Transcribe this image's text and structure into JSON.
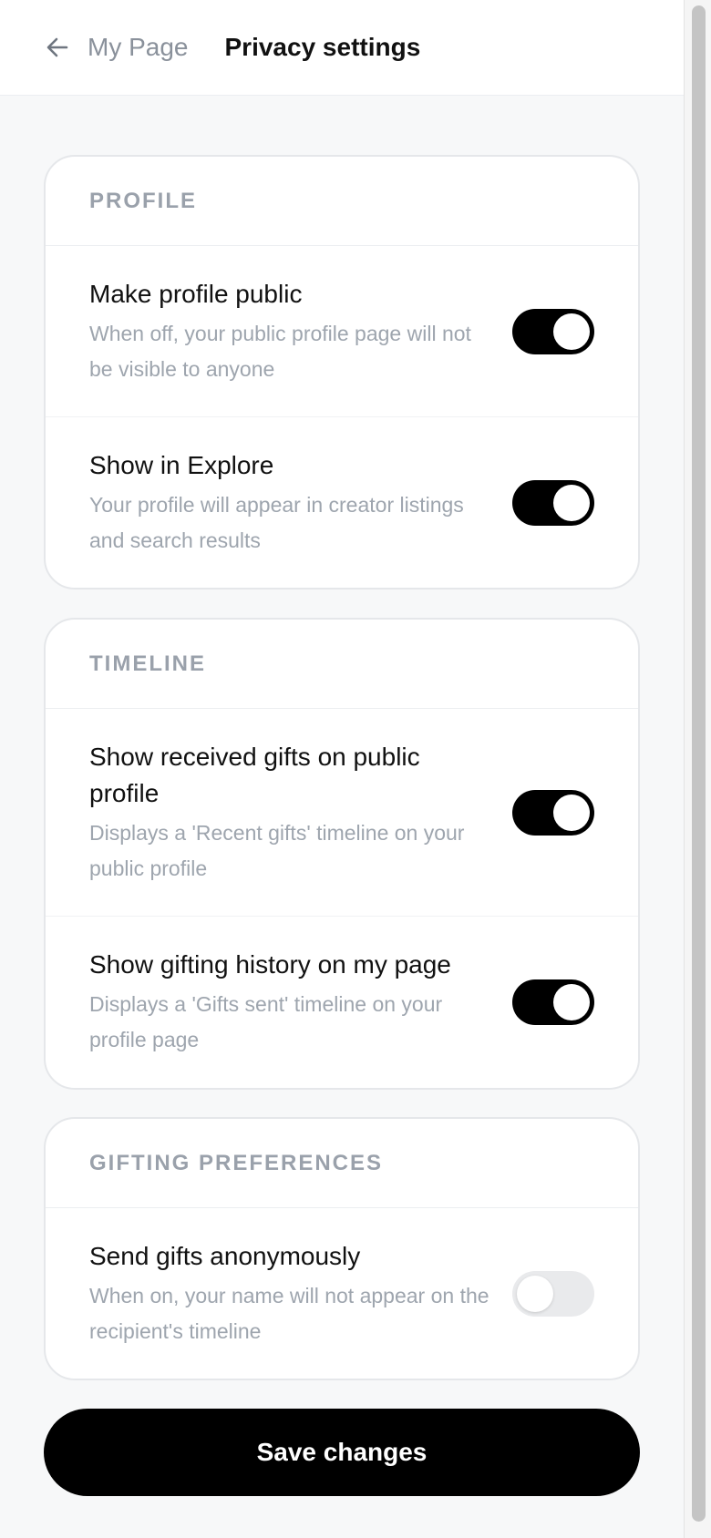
{
  "header": {
    "back_label": "My Page",
    "title": "Privacy settings"
  },
  "sections": [
    {
      "title": "PROFILE",
      "rows": [
        {
          "title": "Make profile public",
          "description": "When off, your public profile page will not be visible to anyone",
          "enabled": true
        },
        {
          "title": "Show in Explore",
          "description": "Your profile will appear in creator listings and search results",
          "enabled": true
        }
      ]
    },
    {
      "title": "TIMELINE",
      "rows": [
        {
          "title": "Show received gifts on public profile",
          "description": "Displays a 'Recent gifts' timeline on your public profile",
          "enabled": true
        },
        {
          "title": "Show gifting history on my page",
          "description": "Displays a 'Gifts sent' timeline on your profile page",
          "enabled": true
        }
      ]
    },
    {
      "title": "GIFTING PREFERENCES",
      "rows": [
        {
          "title": "Send gifts anonymously",
          "description": "When on, your name will not appear on the recipient's timeline",
          "enabled": false
        }
      ]
    }
  ],
  "save_label": "Save changes",
  "colors": {
    "toggle_on": "#000000",
    "toggle_off": "#e9eaec",
    "section_title": "#9aa1ab",
    "description": "#9ea5ae"
  }
}
